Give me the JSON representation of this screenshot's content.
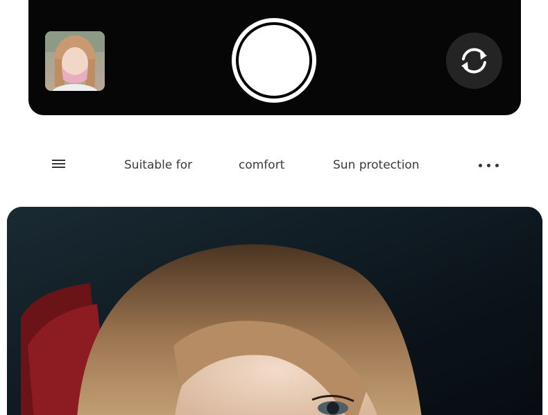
{
  "camera": {
    "thumbnail_icon": "gallery-thumbnail",
    "shutter_icon": "shutter-button",
    "flip_icon": "flip-camera-icon"
  },
  "filter_bar": {
    "menu_icon": "menu-icon",
    "tags": [
      "Suitable for",
      "comfort",
      "Sun protection"
    ],
    "more_icon": "more-icon"
  },
  "colors": {
    "camera_bar": "#060606",
    "flip_button": "#242424",
    "tag_text": "#3a3a3a",
    "photo_background": "#0e1820"
  }
}
